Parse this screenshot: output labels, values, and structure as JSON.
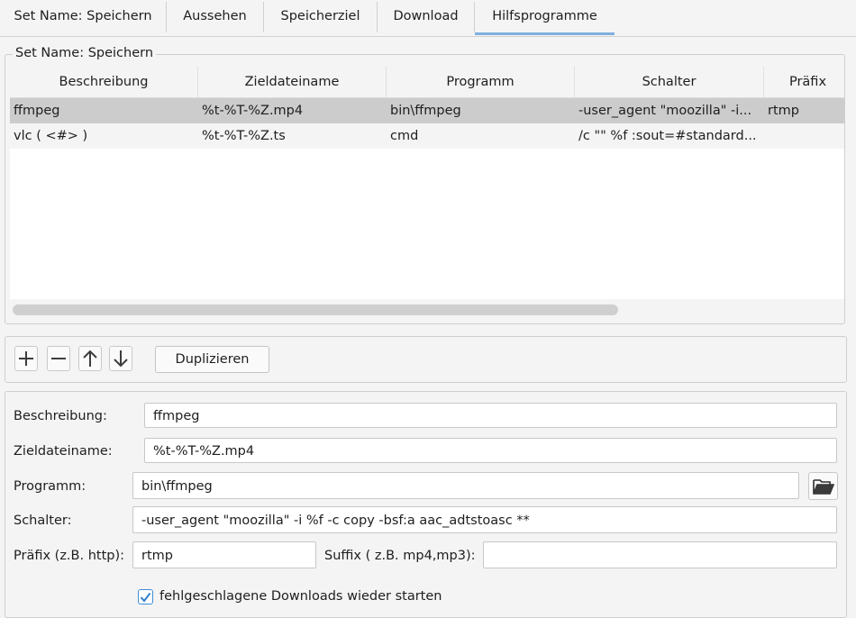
{
  "tabs": [
    "Set Name: Speichern",
    "Aussehen",
    "Speicherziel",
    "Download",
    "Hilfsprogramme"
  ],
  "active_tab": "Hilfsprogramme",
  "set_legend": "Set Name: Speichern",
  "table": {
    "columns": [
      "Beschreibung",
      "Zieldateiname",
      "Programm",
      "Schalter",
      "Präfix"
    ],
    "rows": [
      {
        "beschreibung": "ffmpeg",
        "zieldateiname": "%t-%T-%Z.mp4",
        "programm": "bin\\ffmpeg",
        "schalter": "-user_agent \"moozilla\" -i...",
        "praefix": "rtmp"
      },
      {
        "beschreibung": "vlc ( <#> )",
        "zieldateiname": "%t-%T-%Z.ts",
        "programm": "cmd",
        "schalter": "/c \"\" %f :sout=#standard...",
        "praefix": ""
      }
    ],
    "selected_row": 0
  },
  "toolbar": {
    "icons": [
      "plus-icon",
      "minus-icon",
      "arrow-up-icon",
      "arrow-down-icon"
    ],
    "duplicate_label": "Duplizieren"
  },
  "form": {
    "beschreibung_label": "Beschreibung:",
    "beschreibung_value": "ffmpeg",
    "zieldateiname_label": "Zieldateiname:",
    "zieldateiname_value": "%t-%T-%Z.mp4",
    "programm_label": "Programm:",
    "programm_value": "bin\\ffmpeg",
    "folder_icon": "folder-open-icon",
    "schalter_label": "Schalter:",
    "schalter_value": "-user_agent \"moozilla\" -i %f -c copy -bsf:a aac_adtstoasc **",
    "praefix_label": "Präfix (z.B. http):",
    "praefix_value": "rtmp",
    "suffix_label": "Suffix ( z.B. mp4,mp3):",
    "suffix_value": "",
    "restart_label": "fehlgeschlagene Downloads wieder starten",
    "restart_checked": true
  },
  "colors": {
    "accent": "#7fb0df",
    "checkbox": "#3f8ed8",
    "selected_row": "#cccccc"
  }
}
